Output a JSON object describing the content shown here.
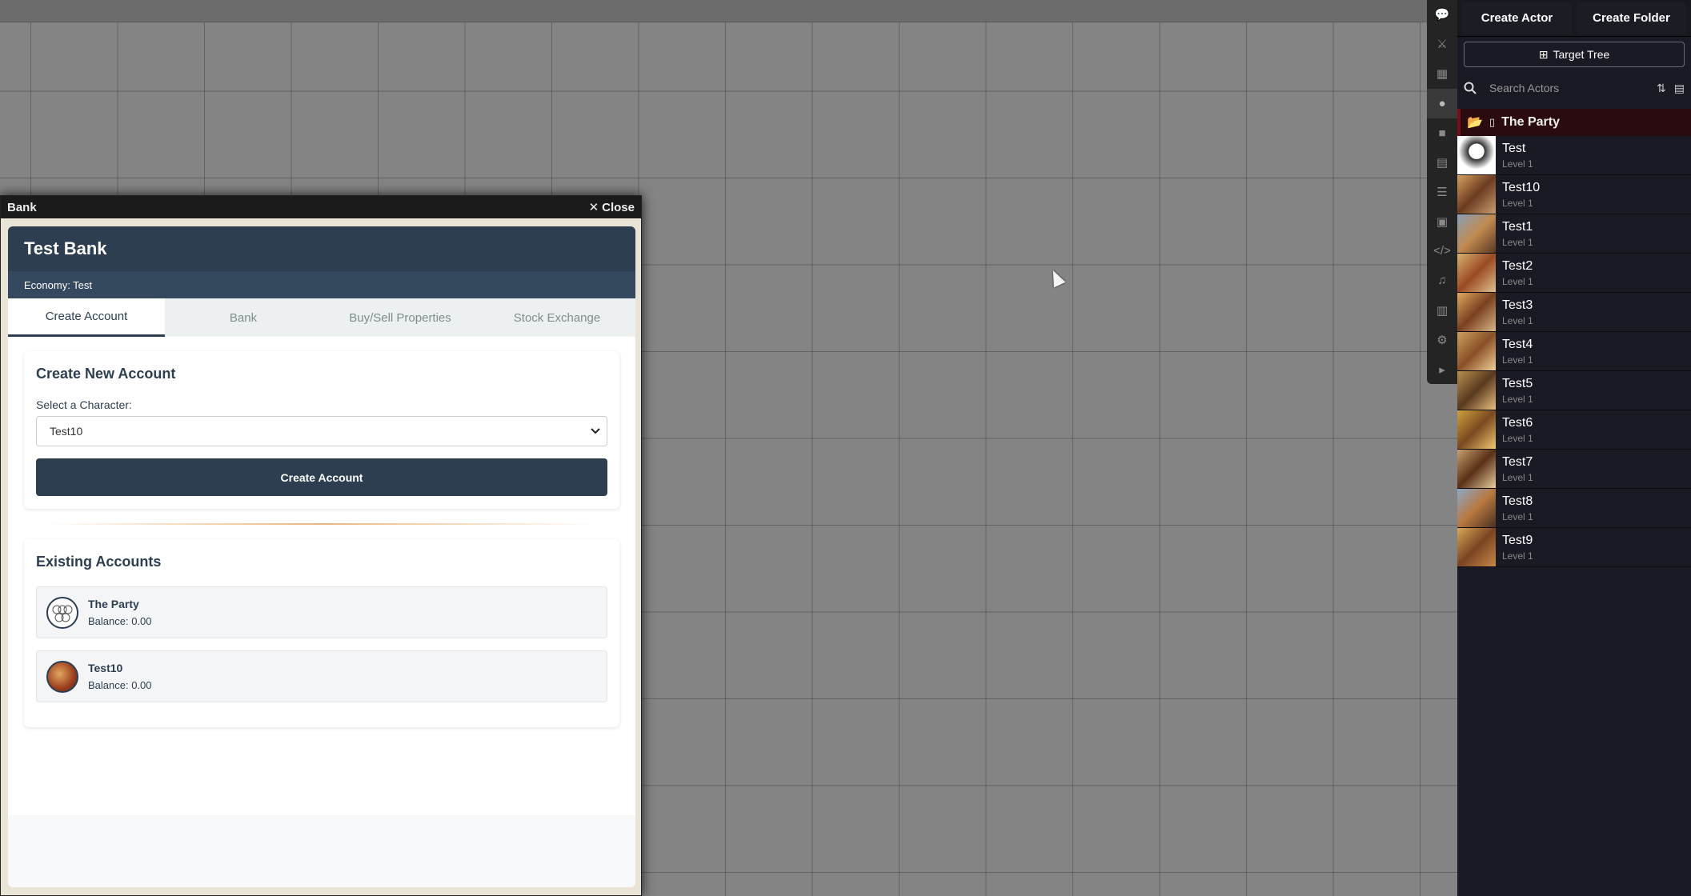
{
  "bank_window": {
    "title": "Bank",
    "close_label": "Close",
    "bank_name": "Test Bank",
    "economy_label": "Economy: Test",
    "tabs": [
      {
        "label": "Create Account",
        "active": true
      },
      {
        "label": "Bank",
        "active": false
      },
      {
        "label": "Buy/Sell Properties",
        "active": false
      },
      {
        "label": "Stock Exchange",
        "active": false
      }
    ],
    "create_section": {
      "heading": "Create New Account",
      "select_label": "Select a Character:",
      "selected_character": "Test10",
      "button_label": "Create Account"
    },
    "existing_section": {
      "heading": "Existing Accounts",
      "accounts": [
        {
          "name": "The Party",
          "balance": "Balance: 0.00"
        },
        {
          "name": "Test10",
          "balance": "Balance: 0.00"
        }
      ]
    }
  },
  "toolbar": {
    "icons": [
      "chat-icon",
      "combat-icon",
      "scenes-icon",
      "actors-icon",
      "items-icon",
      "journal-icon",
      "tables-icon",
      "cards-icon",
      "macros-icon",
      "playlists-icon",
      "compendium-icon",
      "settings-icon",
      "collapse-icon"
    ]
  },
  "sidebar": {
    "create_actor": "Create Actor",
    "create_folder": "Create Folder",
    "target_tree": "Target Tree",
    "search_placeholder": "Search Actors",
    "folder_name": "The Party",
    "actors": [
      {
        "name": "Test",
        "level": "Level 1"
      },
      {
        "name": "Test10",
        "level": "Level 1"
      },
      {
        "name": "Test1",
        "level": "Level 1"
      },
      {
        "name": "Test2",
        "level": "Level 1"
      },
      {
        "name": "Test3",
        "level": "Level 1"
      },
      {
        "name": "Test4",
        "level": "Level 1"
      },
      {
        "name": "Test5",
        "level": "Level 1"
      },
      {
        "name": "Test6",
        "level": "Level 1"
      },
      {
        "name": "Test7",
        "level": "Level 1"
      },
      {
        "name": "Test8",
        "level": "Level 1"
      },
      {
        "name": "Test9",
        "level": "Level 1"
      }
    ]
  },
  "colors": {
    "bank_dark": "#2c3e50",
    "bank_sub": "#34495e",
    "sidebar_bg": "#1a1a24",
    "folder_accent": "#7a0f18"
  }
}
